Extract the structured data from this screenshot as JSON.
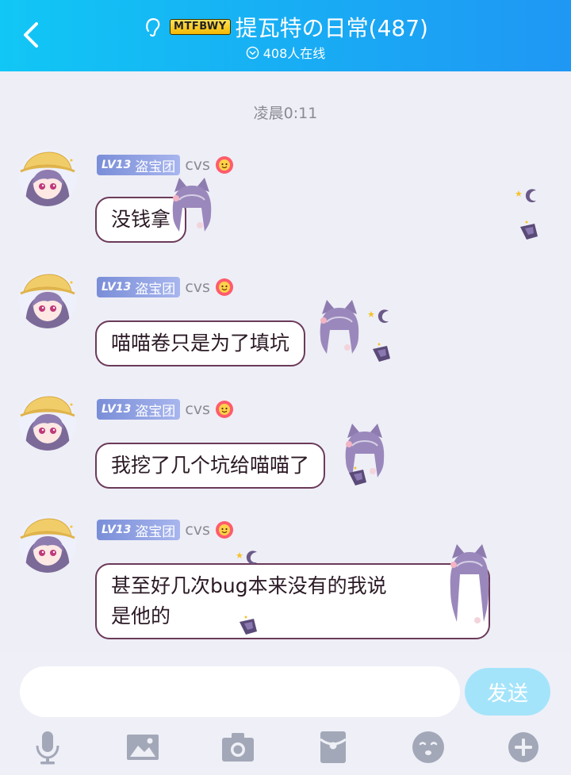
{
  "header": {
    "brand_badge": "MTFBWY",
    "title": "提瓦特の日常(487)",
    "online": "408人在线",
    "background_colors": [
      "#11c7f5",
      "#1f97f4"
    ]
  },
  "timestamp": "凌晨0:11",
  "messages": [
    {
      "level": "LV13",
      "title_badge": "盗宝团",
      "nickname": "cvs",
      "text_lines": [
        "没钱拿"
      ]
    },
    {
      "level": "LV13",
      "title_badge": "盗宝团",
      "nickname": "cvs",
      "text_lines": [
        "喵喵卷只是为了填坑"
      ]
    },
    {
      "level": "LV13",
      "title_badge": "盗宝团",
      "nickname": "cvs",
      "text_lines": [
        "我挖了几个坑给喵喵了"
      ]
    },
    {
      "level": "LV13",
      "title_badge": "盗宝团",
      "nickname": "cvs",
      "text_lines": [
        "甚至好几次bug本来没有的我说",
        "是他的"
      ]
    }
  ],
  "composer": {
    "input_value": "",
    "send_label": "发送",
    "send_color": "#a4e4fb"
  },
  "toolbar": {
    "icons": [
      "microphone-icon",
      "image-icon",
      "camera-icon",
      "red-packet-icon",
      "emoji-icon",
      "plus-icon"
    ]
  },
  "colors": {
    "bubble_border": "#6b3a5a",
    "level_badge": "#8a9ae0",
    "background": "#eeeef6"
  }
}
